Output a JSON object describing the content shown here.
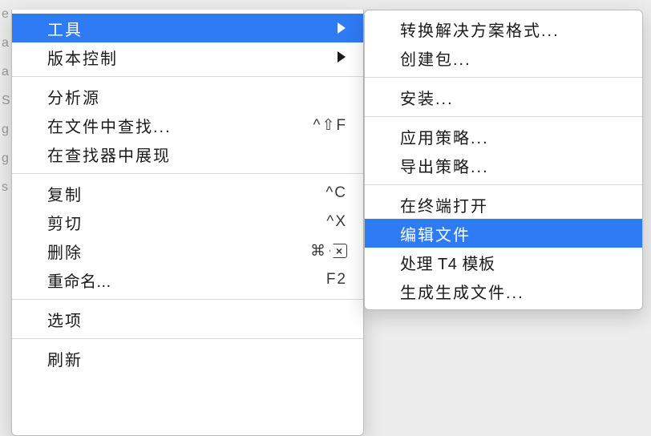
{
  "backdrop_chars": [
    "e",
    "a",
    "a",
    "S",
    "g",
    "g",
    "s"
  ],
  "main_menu": {
    "groups": [
      [
        {
          "label": "工具",
          "has_submenu": true,
          "highlight": true,
          "name": "menu-tools"
        },
        {
          "label": "版本控制",
          "has_submenu": true,
          "name": "menu-version-control"
        }
      ],
      [
        {
          "label": "分析源",
          "name": "menu-analyze-source"
        },
        {
          "label": "在文件中查找...",
          "shortcut": "^⇧F",
          "name": "menu-find-in-files"
        },
        {
          "label": "在查找器中展现",
          "name": "menu-reveal-in-finder"
        }
      ],
      [
        {
          "label": "复制",
          "shortcut": "^C",
          "name": "menu-copy"
        },
        {
          "label": "剪切",
          "shortcut": "^X",
          "name": "menu-cut"
        },
        {
          "label": "删除",
          "shortcut": "⌘",
          "delete_key": true,
          "name": "menu-delete"
        },
        {
          "label": "重命名...",
          "shortcut": "F2",
          "tight": true,
          "name": "menu-rename"
        }
      ],
      [
        {
          "label": "选项",
          "name": "menu-options"
        }
      ],
      [
        {
          "label": "刷新",
          "name": "menu-refresh"
        }
      ]
    ]
  },
  "sub_menu": {
    "groups": [
      [
        {
          "label": "转换解决方案格式...",
          "name": "submenu-convert-solution-format"
        },
        {
          "label": "创建包...",
          "name": "submenu-create-package"
        }
      ],
      [
        {
          "label": "安装...",
          "name": "submenu-install"
        }
      ],
      [
        {
          "label": "应用策略...",
          "name": "submenu-apply-policy"
        },
        {
          "label": "导出策略...",
          "name": "submenu-export-policy"
        }
      ],
      [
        {
          "label": "在终端打开",
          "name": "submenu-open-in-terminal"
        },
        {
          "label": "编辑文件",
          "highlight": true,
          "name": "submenu-edit-file"
        },
        {
          "label": "处理 T4 模板",
          "tight": true,
          "name": "submenu-process-t4"
        },
        {
          "label": "生成生成文件...",
          "name": "submenu-generate-makefile"
        }
      ]
    ]
  }
}
